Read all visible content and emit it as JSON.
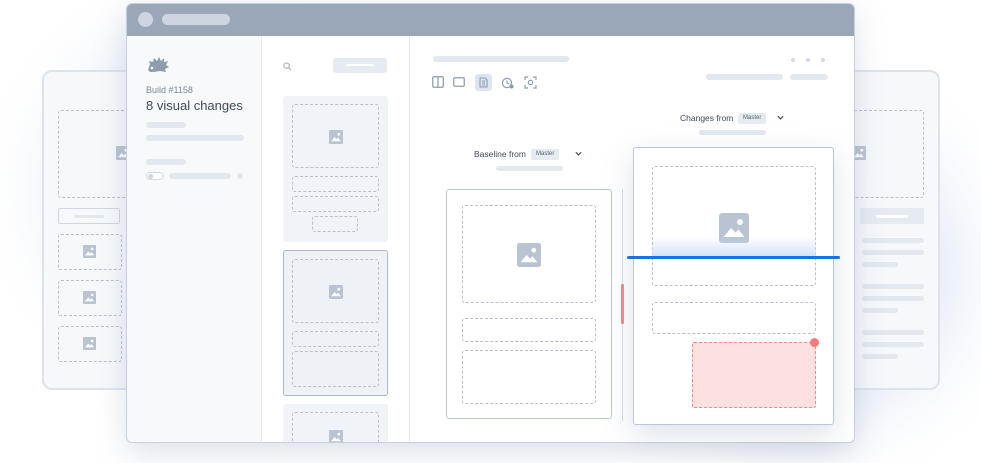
{
  "colors": {
    "titlebar": "#99a7b9",
    "accent_blue": "#1b6fdf",
    "diff_red_fill": "#fde1e1",
    "diff_red_border": "#f08a8a",
    "diff_red_dot": "#f27b7b",
    "panel_border": "#b8c6db",
    "placeholder": "#e3e8ef",
    "image_icon": "#b9c3d1"
  },
  "sidebar": {
    "build_label": "Build #1158",
    "summary": "8 visual changes",
    "logo_icon": "hedgehog-logo-icon"
  },
  "toolbar": {
    "icons": [
      "split-view-icon",
      "single-view-icon",
      "diff-view-icon",
      "history-icon",
      "focus-icon"
    ]
  },
  "baseline": {
    "label": "Baseline from",
    "branch": "Master"
  },
  "changes": {
    "label": "Changes from",
    "branch": "Master"
  }
}
